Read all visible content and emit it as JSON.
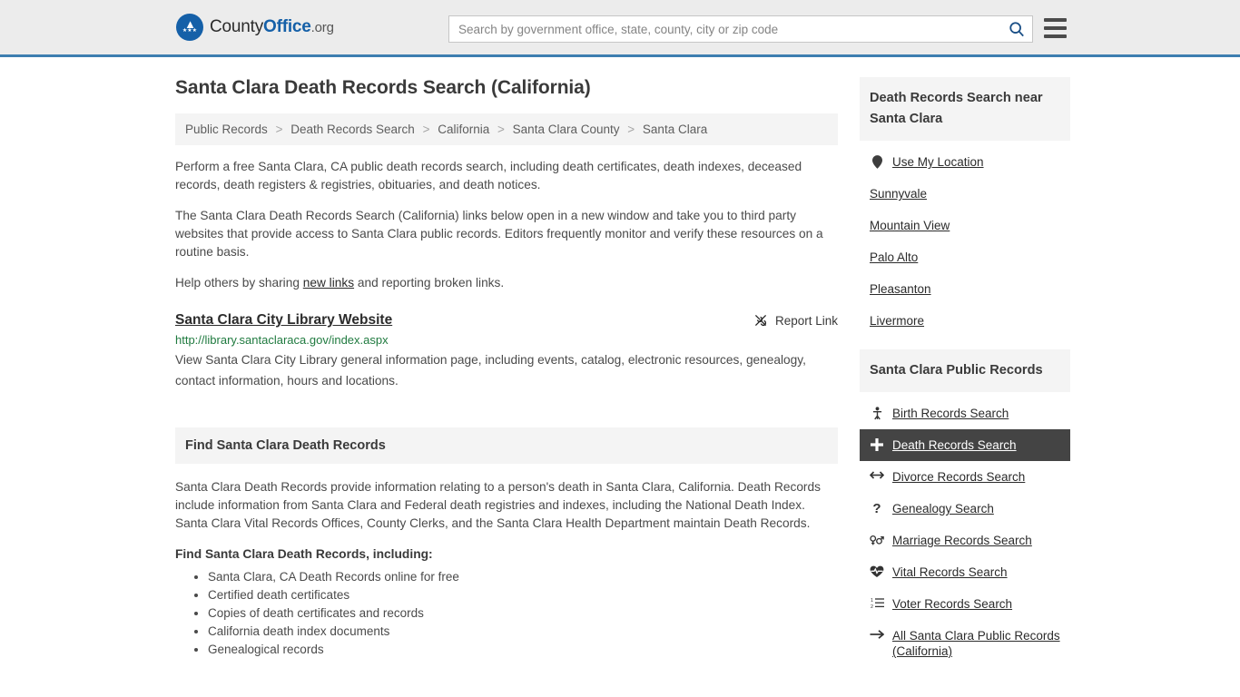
{
  "header": {
    "logo": {
      "name_part1": "County",
      "name_part2": "Office",
      "suffix": ".org",
      "icon": "eagle-seal-icon"
    },
    "search": {
      "placeholder": "Search by government office, state, county, city or zip code",
      "value": "",
      "icon": "search-icon"
    },
    "menu_icon": "hamburger-menu-icon"
  },
  "main": {
    "title": "Santa Clara Death Records Search (California)",
    "breadcrumb": [
      "Public Records",
      "Death Records Search",
      "California",
      "Santa Clara County",
      "Santa Clara"
    ],
    "breadcrumb_separator": ">",
    "paragraphs": {
      "p1": "Perform a free Santa Clara, CA public death records search, including death certificates, death indexes, deceased records, death registers & registries, obituaries, and death notices.",
      "p2": "The Santa Clara Death Records Search (California) links below open in a new window and take you to third party websites that provide access to Santa Clara public records. Editors frequently monitor and verify these resources on a routine basis.",
      "p3_before": "Help others by sharing ",
      "p3_link": "new links",
      "p3_after": " and reporting broken links."
    },
    "result": {
      "title": "Santa Clara City Library Website",
      "report_label": "Report Link",
      "report_icon": "broken-link-icon",
      "url": "http://library.santaclaraca.gov/index.aspx",
      "description": "View Santa Clara City Library general information page, including events, catalog, electronic resources, genealogy, contact information, hours and locations."
    },
    "section": {
      "heading": "Find Santa Clara Death Records",
      "paragraph": "Santa Clara Death Records provide information relating to a person's death in Santa Clara, California. Death Records include information from Santa Clara and Federal death registries and indexes, including the National Death Index. Santa Clara Vital Records Offices, County Clerks, and the Santa Clara Health Department maintain Death Records.",
      "subheading": "Find Santa Clara Death Records, including:",
      "bullets": [
        "Santa Clara, CA Death Records online for free",
        "Certified death certificates",
        "Copies of death certificates and records",
        "California death index documents",
        "Genealogical records"
      ]
    }
  },
  "sidebar": {
    "near_panel": {
      "title": "Death Records Search near Santa Clara",
      "items": [
        {
          "label": "Use My Location",
          "icon": "map-pin-icon"
        },
        {
          "label": "Sunnyvale",
          "icon": ""
        },
        {
          "label": "Mountain View",
          "icon": ""
        },
        {
          "label": "Palo Alto",
          "icon": ""
        },
        {
          "label": "Pleasanton",
          "icon": ""
        },
        {
          "label": "Livermore",
          "icon": ""
        }
      ]
    },
    "records_panel": {
      "title": "Santa Clara Public Records",
      "items": [
        {
          "label": "Birth Records Search",
          "icon": "baby-icon",
          "active": false
        },
        {
          "label": "Death Records Search",
          "icon": "plus-cross-icon",
          "active": true
        },
        {
          "label": "Divorce Records Search",
          "icon": "left-right-arrow-icon",
          "active": false
        },
        {
          "label": "Genealogy Search",
          "icon": "question-mark-icon",
          "active": false
        },
        {
          "label": "Marriage Records Search",
          "icon": "male-female-icon",
          "active": false
        },
        {
          "label": "Vital Records Search",
          "icon": "heartbeat-icon",
          "active": false
        },
        {
          "label": "Voter Records Search",
          "icon": "ordered-list-icon",
          "active": false
        },
        {
          "label": "All Santa Clara Public Records (California)",
          "icon": "arrow-right-icon",
          "active": false
        }
      ]
    }
  },
  "colors": {
    "header_bg": "#ececec",
    "header_border": "#3d7eb0",
    "brand_blue": "#1560a8",
    "panel_bg": "#f4f4f4",
    "active_bg": "#444444",
    "url_green": "#1f7a3f"
  }
}
